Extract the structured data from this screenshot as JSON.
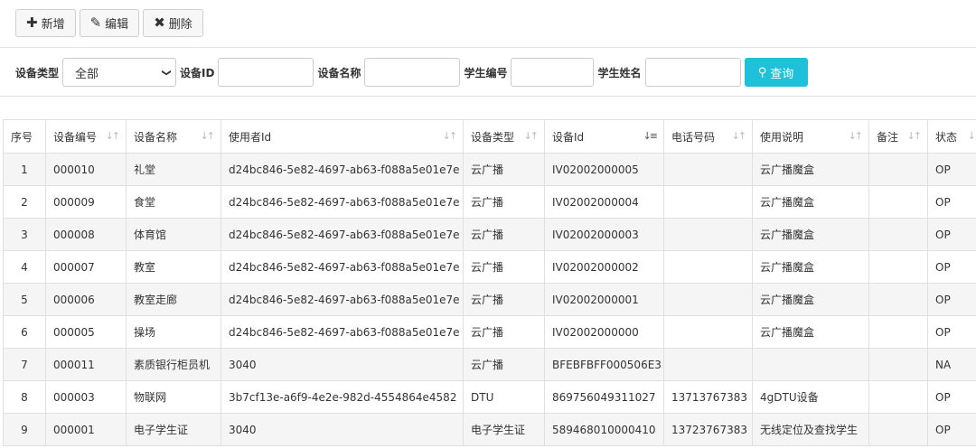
{
  "toolbar": {
    "add_label": "新增",
    "edit_label": "编辑",
    "delete_label": "删除",
    "add_icon": "plus-icon",
    "edit_icon": "pencil-icon",
    "delete_icon": "times-icon"
  },
  "filters": {
    "device_type_label": "设备类型",
    "device_type_value": "全部",
    "device_id_label": "设备ID",
    "device_name_label": "设备名称",
    "student_no_label": "学生编号",
    "student_name_label": "学生姓名",
    "device_id_value": "",
    "device_name_value": "",
    "student_no_value": "",
    "student_name_value": "",
    "query_label": "查询",
    "query_color": "#1fc0d9"
  },
  "table": {
    "headers": [
      "序号",
      "设备编号",
      "设备名称",
      "使用者Id",
      "设备类型",
      "设备Id",
      "电话号码",
      "使用说明",
      "备注",
      "状态"
    ],
    "rows": [
      [
        "1",
        "000010",
        "礼堂",
        "d24bc846-5e82-4697-ab63-f088a5e01e7e",
        "云广播",
        "IV02002000005",
        "",
        "云广播魔盒",
        "",
        "OP"
      ],
      [
        "2",
        "000009",
        "食堂",
        "d24bc846-5e82-4697-ab63-f088a5e01e7e",
        "云广播",
        "IV02002000004",
        "",
        "云广播魔盒",
        "",
        "OP"
      ],
      [
        "3",
        "000008",
        "体育馆",
        "d24bc846-5e82-4697-ab63-f088a5e01e7e",
        "云广播",
        "IV02002000003",
        "",
        "云广播魔盒",
        "",
        "OP"
      ],
      [
        "4",
        "000007",
        "教室",
        "d24bc846-5e82-4697-ab63-f088a5e01e7e",
        "云广播",
        "IV02002000002",
        "",
        "云广播魔盒",
        "",
        "OP"
      ],
      [
        "5",
        "000006",
        "教室走廊",
        "d24bc846-5e82-4697-ab63-f088a5e01e7e",
        "云广播",
        "IV02002000001",
        "",
        "云广播魔盒",
        "",
        "OP"
      ],
      [
        "6",
        "000005",
        "操场",
        "d24bc846-5e82-4697-ab63-f088a5e01e7e",
        "云广播",
        "IV02002000000",
        "",
        "云广播魔盒",
        "",
        "OP"
      ],
      [
        "7",
        "000011",
        "素质银行柜员机",
        "3040",
        "云广播",
        "BFEBFBFF000506E3",
        "",
        "",
        "",
        "NA"
      ],
      [
        "8",
        "000003",
        "物联网",
        "3b7cf13e-a6f9-4e2e-982d-4554864e4582",
        "DTU",
        "869756049311027",
        "13713767383",
        "4gDTU设备",
        "",
        "OP"
      ],
      [
        "9",
        "000001",
        "电子学生证",
        "3040",
        "电子学生证",
        "589468010000410",
        "13723767383",
        "无线定位及查找学生",
        "",
        "OP"
      ]
    ]
  }
}
